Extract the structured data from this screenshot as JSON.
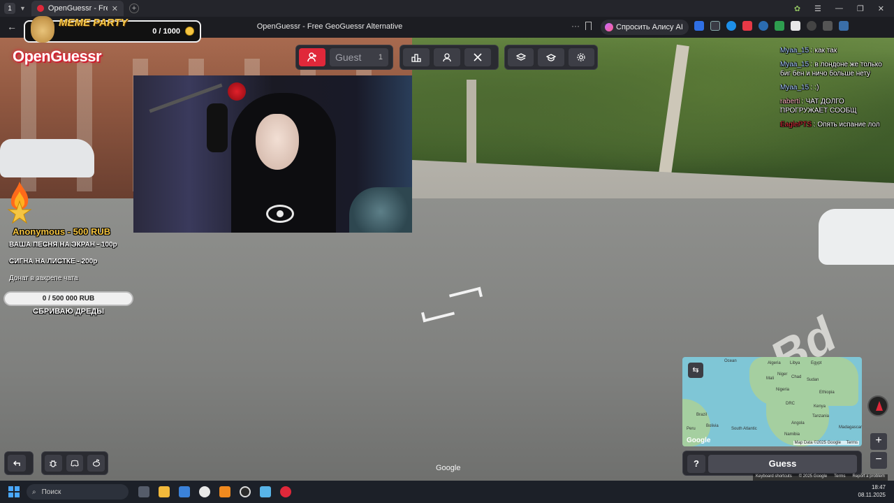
{
  "browser": {
    "tab_count": "1",
    "tab_title": "OpenGuessr - Free Geo",
    "page_title": "OpenGuessr - Free GeoGuessr Alternative",
    "alice_label": "Спросить Алису AI",
    "more_label": "···"
  },
  "overlay": {
    "meme_title": "MEME PARTY",
    "meme_progress": "0 / 1000",
    "logo": "OpenGuessr",
    "donor": "Anonymous - 500 RUB",
    "price_song": "ВАША ПЕСНЯ НА ЭКРАН - 100р",
    "price_sign": "СИГНА  НА ЛИСТКЕ - 200р",
    "donate_note": "Донат в закрепе чата",
    "goal_text": "0 / 500 000 RUB",
    "goal_progress": 0,
    "goal_caption": "СБРИВАЮ ДРЕДЫ"
  },
  "game": {
    "guest_label": "Guest",
    "guest_count": "1",
    "guess_label": "Guess",
    "help_label": "?",
    "google_watermark": "Google",
    "road_text": "Bd de"
  },
  "chat": [
    {
      "user": "Myaa_15",
      "user_color": "#a6c8ff",
      "text": "как так"
    },
    {
      "user": "Myaa_15",
      "user_color": "#a6c8ff",
      "text": "в лондоне же только биг бен и ничо больше нету"
    },
    {
      "user": "Myaa_15",
      "user_color": "#a6c8ff",
      "text": ":)"
    },
    {
      "user": "raberti",
      "user_color": "#ffb0c0",
      "text": "ЧАТ ДОЛГО ПРОГРУЖАЕТ СООБЩ"
    },
    {
      "user": "EaglePTS",
      "user_color": "#e0283a",
      "text": "Опять испание лол"
    }
  ],
  "map": {
    "labels": [
      "Ocean",
      "Algeria",
      "Libya",
      "Egypt",
      "Mali",
      "Niger",
      "Chad",
      "Sudan",
      "Nigeria",
      "Ethiopia",
      "DRC",
      "Kenya",
      "Tanzania",
      "Angola",
      "Namibia",
      "Brazil",
      "Peru",
      "Bolivia",
      "South Atlantic",
      "Madagascar"
    ],
    "credit": "Map Data ©2025 Google",
    "terms": "Terms",
    "google": "Google"
  },
  "footer_links": [
    "Keyboard shortcuts",
    "© 2025 Google",
    "Terms",
    "Report a problem"
  ],
  "taskbar": {
    "search_placeholder": "Поиск",
    "time": "18:47",
    "date": "08.11.2025"
  },
  "colors": {
    "accent": "#e0283a",
    "gold": "#f5c542"
  }
}
